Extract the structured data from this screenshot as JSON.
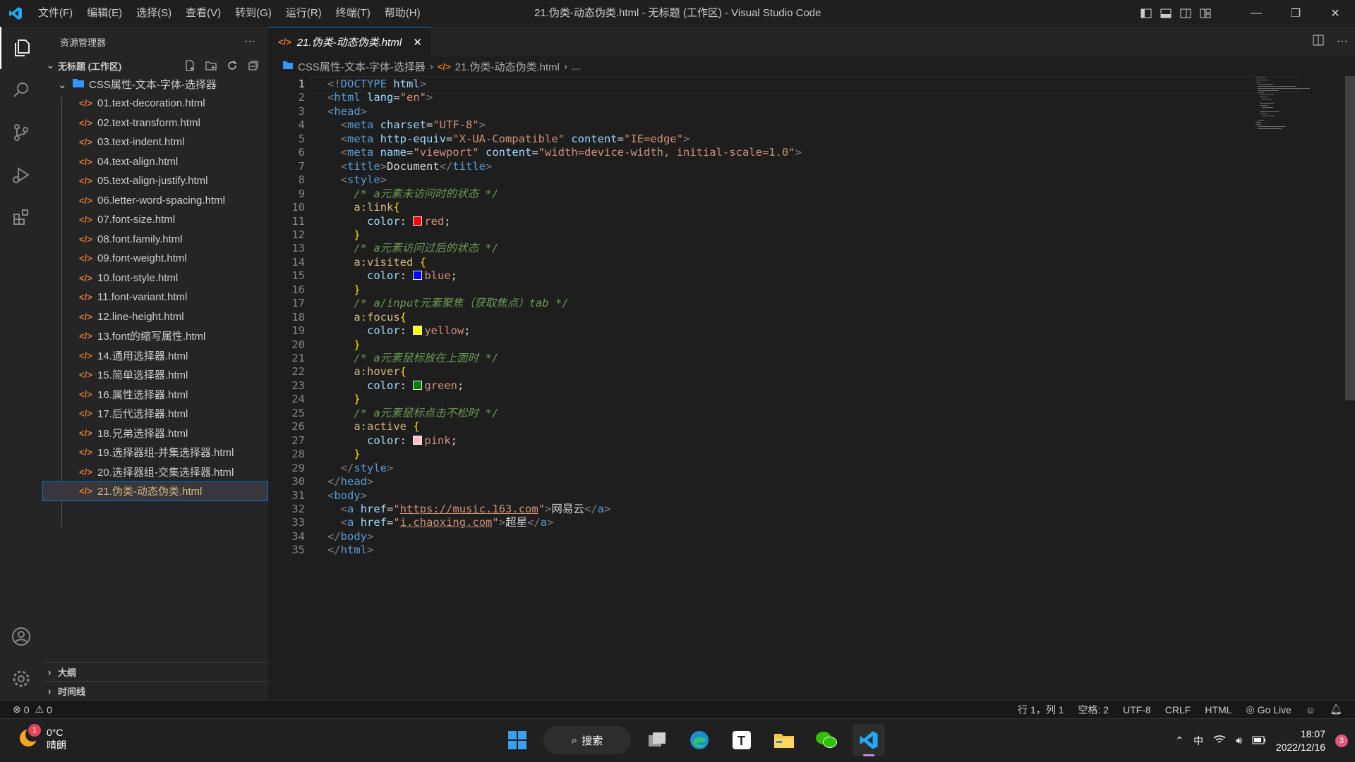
{
  "titlebar": {
    "menus": [
      "文件(F)",
      "编辑(E)",
      "选择(S)",
      "查看(V)",
      "转到(G)",
      "运行(R)",
      "终端(T)",
      "帮助(H)"
    ],
    "title": "21.伪类-动态伪类.html - 无标题 (工作区) - Visual Studio Code"
  },
  "sidebar": {
    "header": "资源管理器",
    "more": "···",
    "workspace": "无标题 (工作区)",
    "folder": "CSS属性-文本-字体-选择器",
    "file_icon": "</>",
    "files": [
      "01.text-decoration.html",
      "02.text-transform.html",
      "03.text-indent.html",
      "04.text-align.html",
      "05.text-align-justify.html",
      "06.letter-word-spacing.html",
      "07.font-size.html",
      "08.font.family.html",
      "09.font-weight.html",
      "10.font-style.html",
      "11.font-variant.html",
      "12.line-height.html",
      "13.font的缩写属性.html",
      "14.通用选择器.html",
      "15.简单选择器.html",
      "16.属性选择器.html",
      "17.后代选择器.html",
      "18.兄弟选择器.html",
      "19.选择器组-并集选择器.html",
      "20.选择器组-交集选择器.html",
      "21.伪类-动态伪类.html"
    ],
    "outline": "大纲",
    "timeline": "时间线"
  },
  "tab": {
    "label": "21.伪类-动态伪类.html"
  },
  "breadcrumb": {
    "folder": "CSS属性-文本-字体-选择器",
    "file": "21.伪类-动态伪类.html",
    "more": "..."
  },
  "code": {
    "line_numbers": [
      "1",
      "2",
      "3",
      "4",
      "5",
      "6",
      "7",
      "8",
      "9",
      "10",
      "11",
      "12",
      "13",
      "14",
      "15",
      "16",
      "17",
      "18",
      "19",
      "20",
      "21",
      "22",
      "23",
      "24",
      "25",
      "26",
      "27",
      "28",
      "29",
      "30",
      "31",
      "32",
      "33",
      "34",
      "35"
    ],
    "swatch_colors": {
      "red": "#ff0000",
      "blue": "#0000ff",
      "yellow": "#ffff00",
      "green": "#008000",
      "pink": "#ffc0cb"
    },
    "lines": [
      [
        [
          "t",
          "<!"
        ],
        [
          "tag",
          "DOCTYPE"
        ],
        [
          "at",
          " html"
        ],
        [
          "t",
          ">"
        ]
      ],
      [
        [
          "t",
          "<"
        ],
        [
          "tag",
          "html"
        ],
        [
          "at",
          " lang"
        ],
        [
          "txt",
          "="
        ],
        [
          "str",
          "\"en\""
        ],
        [
          "t",
          ">"
        ]
      ],
      [
        [
          "t",
          "<"
        ],
        [
          "tag",
          "head"
        ],
        [
          "t",
          ">"
        ]
      ],
      [
        [
          "txt",
          "  "
        ],
        [
          "t",
          "<"
        ],
        [
          "tag",
          "meta"
        ],
        [
          "at",
          " charset"
        ],
        [
          "txt",
          "="
        ],
        [
          "str",
          "\"UTF-8\""
        ],
        [
          "t",
          ">"
        ]
      ],
      [
        [
          "txt",
          "  "
        ],
        [
          "t",
          "<"
        ],
        [
          "tag",
          "meta"
        ],
        [
          "at",
          " http-equiv"
        ],
        [
          "txt",
          "="
        ],
        [
          "str",
          "\"X-UA-Compatible\""
        ],
        [
          "at",
          " content"
        ],
        [
          "txt",
          "="
        ],
        [
          "str",
          "\"IE=edge\""
        ],
        [
          "t",
          ">"
        ]
      ],
      [
        [
          "txt",
          "  "
        ],
        [
          "t",
          "<"
        ],
        [
          "tag",
          "meta"
        ],
        [
          "at",
          " name"
        ],
        [
          "txt",
          "="
        ],
        [
          "str",
          "\"viewport\""
        ],
        [
          "at",
          " content"
        ],
        [
          "txt",
          "="
        ],
        [
          "str",
          "\"width=device-width, initial-scale=1.0\""
        ],
        [
          "t",
          ">"
        ]
      ],
      [
        [
          "txt",
          "  "
        ],
        [
          "t",
          "<"
        ],
        [
          "tag",
          "title"
        ],
        [
          "t",
          ">"
        ],
        [
          "txt",
          "Document"
        ],
        [
          "t",
          "</"
        ],
        [
          "tag",
          "title"
        ],
        [
          "t",
          ">"
        ]
      ],
      [
        [
          "txt",
          "  "
        ],
        [
          "t",
          "<"
        ],
        [
          "tag",
          "style"
        ],
        [
          "t",
          ">"
        ]
      ],
      [
        [
          "txt",
          "    "
        ],
        [
          "cm",
          "/* a元素未访问时的状态 */"
        ]
      ],
      [
        [
          "txt",
          "    "
        ],
        [
          "sel",
          "a:link"
        ],
        [
          "br",
          "{"
        ]
      ],
      [
        [
          "txt",
          "      "
        ],
        [
          "prop",
          "color"
        ],
        [
          "txt",
          ": "
        ],
        [
          "swatch",
          "red"
        ],
        [
          "val",
          "red"
        ],
        [
          "txt",
          ";"
        ]
      ],
      [
        [
          "txt",
          "    "
        ],
        [
          "br",
          "}"
        ]
      ],
      [
        [
          "txt",
          "    "
        ],
        [
          "cm",
          "/* a元素访问过后的状态 */"
        ]
      ],
      [
        [
          "txt",
          "    "
        ],
        [
          "sel",
          "a:visited"
        ],
        [
          "txt",
          " "
        ],
        [
          "br",
          "{"
        ]
      ],
      [
        [
          "txt",
          "      "
        ],
        [
          "prop",
          "color"
        ],
        [
          "txt",
          ": "
        ],
        [
          "swatch",
          "blue"
        ],
        [
          "val",
          "blue"
        ],
        [
          "txt",
          ";"
        ]
      ],
      [
        [
          "txt",
          "    "
        ],
        [
          "br",
          "}"
        ]
      ],
      [
        [
          "txt",
          "    "
        ],
        [
          "cm",
          "/* a/input元素聚焦（获取焦点）tab */"
        ]
      ],
      [
        [
          "txt",
          "    "
        ],
        [
          "sel",
          "a:focus"
        ],
        [
          "br",
          "{"
        ]
      ],
      [
        [
          "txt",
          "      "
        ],
        [
          "prop",
          "color"
        ],
        [
          "txt",
          ": "
        ],
        [
          "swatch",
          "yellow"
        ],
        [
          "val",
          "yellow"
        ],
        [
          "txt",
          ";"
        ]
      ],
      [
        [
          "txt",
          "    "
        ],
        [
          "br",
          "}"
        ]
      ],
      [
        [
          "txt",
          "    "
        ],
        [
          "cm",
          "/* a元素鼠标放在上面时 */"
        ]
      ],
      [
        [
          "txt",
          "    "
        ],
        [
          "sel",
          "a:hover"
        ],
        [
          "br",
          "{"
        ]
      ],
      [
        [
          "txt",
          "      "
        ],
        [
          "prop",
          "color"
        ],
        [
          "txt",
          ": "
        ],
        [
          "swatch",
          "green"
        ],
        [
          "val",
          "green"
        ],
        [
          "txt",
          ";"
        ]
      ],
      [
        [
          "txt",
          "    "
        ],
        [
          "br",
          "}"
        ]
      ],
      [
        [
          "txt",
          "    "
        ],
        [
          "cm",
          "/* a元素鼠标点击不松时 */"
        ]
      ],
      [
        [
          "txt",
          "    "
        ],
        [
          "sel",
          "a:active"
        ],
        [
          "txt",
          " "
        ],
        [
          "br",
          "{"
        ]
      ],
      [
        [
          "txt",
          "      "
        ],
        [
          "prop",
          "color"
        ],
        [
          "txt",
          ": "
        ],
        [
          "swatch",
          "pink"
        ],
        [
          "val",
          "pink"
        ],
        [
          "txt",
          ";"
        ]
      ],
      [
        [
          "txt",
          "    "
        ],
        [
          "br",
          "}"
        ]
      ],
      [
        [
          "txt",
          "  "
        ],
        [
          "t",
          "</"
        ],
        [
          "tag",
          "style"
        ],
        [
          "t",
          ">"
        ]
      ],
      [
        [
          "t",
          "</"
        ],
        [
          "tag",
          "head"
        ],
        [
          "t",
          ">"
        ]
      ],
      [
        [
          "t",
          "<"
        ],
        [
          "tag",
          "body"
        ],
        [
          "t",
          ">"
        ]
      ],
      [
        [
          "txt",
          "  "
        ],
        [
          "t",
          "<"
        ],
        [
          "tag",
          "a"
        ],
        [
          "at",
          " href"
        ],
        [
          "txt",
          "="
        ],
        [
          "str",
          "\""
        ],
        [
          "url",
          "https://music.163.com"
        ],
        [
          "str",
          "\""
        ],
        [
          "t",
          ">"
        ],
        [
          "txt",
          "网易云"
        ],
        [
          "t",
          "</"
        ],
        [
          "tag",
          "a"
        ],
        [
          "t",
          ">"
        ]
      ],
      [
        [
          "txt",
          "  "
        ],
        [
          "t",
          "<"
        ],
        [
          "tag",
          "a"
        ],
        [
          "at",
          " href"
        ],
        [
          "txt",
          "="
        ],
        [
          "str",
          "\""
        ],
        [
          "url",
          "i.chaoxing.com"
        ],
        [
          "str",
          "\""
        ],
        [
          "t",
          ">"
        ],
        [
          "txt",
          "超星"
        ],
        [
          "t",
          "</"
        ],
        [
          "tag",
          "a"
        ],
        [
          "t",
          ">"
        ]
      ],
      [
        [
          "t",
          "</"
        ],
        [
          "tag",
          "body"
        ],
        [
          "t",
          ">"
        ]
      ],
      [
        [
          "t",
          "</"
        ],
        [
          "tag",
          "html"
        ],
        [
          "t",
          ">"
        ]
      ]
    ]
  },
  "statusbar": {
    "errors": "0",
    "warnings": "0",
    "position": "行 1，列 1",
    "spaces": "空格: 2",
    "encoding": "UTF-8",
    "eol": "CRLF",
    "language": "HTML",
    "golive": "Go Live"
  },
  "taskbar": {
    "temp": "0°C",
    "weather": "晴朗",
    "weather_badge": "1",
    "search": "搜索",
    "ime": "中",
    "time": "18:07",
    "date": "2022/12/16",
    "notif_count": "3"
  }
}
